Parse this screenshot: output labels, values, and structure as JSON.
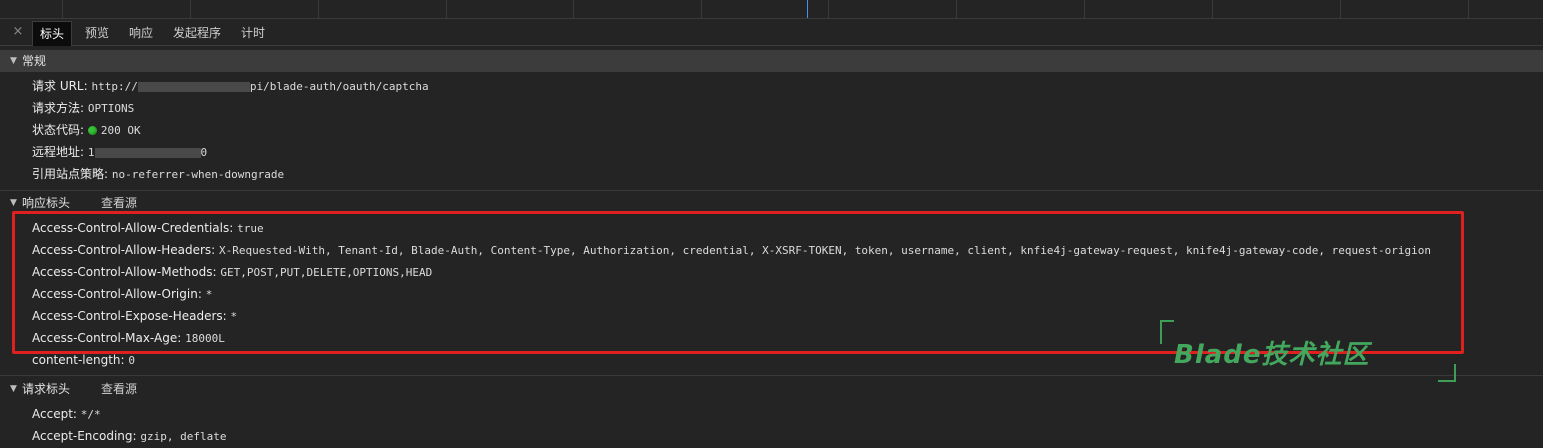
{
  "tabs": {
    "close": "×",
    "items": [
      "标头",
      "预览",
      "响应",
      "发起程序",
      "计时"
    ],
    "active": "标头"
  },
  "general": {
    "title": "常规",
    "request_url_label": "请求 URL:",
    "request_url_prefix": "http://",
    "request_url_suffix": "pi/blade-auth/oauth/captcha",
    "request_method_label": "请求方法:",
    "request_method": "OPTIONS",
    "status_code_label": "状态代码:",
    "status_code": "200 OK",
    "remote_address_label": "远程地址:",
    "remote_address_prefix": "1",
    "remote_address_suffix": "0",
    "referrer_policy_label": "引用站点策略:",
    "referrer_policy": "no-referrer-when-downgrade"
  },
  "response_headers": {
    "title": "响应标头",
    "view_source": "查看源",
    "items": [
      {
        "key": "Access-Control-Allow-Credentials:",
        "value": "true"
      },
      {
        "key": "Access-Control-Allow-Headers:",
        "value": "X-Requested-With, Tenant-Id, Blade-Auth, Content-Type, Authorization, credential, X-XSRF-TOKEN, token, username, client, knfie4j-gateway-request, knife4j-gateway-code, request-origion"
      },
      {
        "key": "Access-Control-Allow-Methods:",
        "value": "GET,POST,PUT,DELETE,OPTIONS,HEAD"
      },
      {
        "key": "Access-Control-Allow-Origin:",
        "value": "*"
      },
      {
        "key": "Access-Control-Expose-Headers:",
        "value": "*"
      },
      {
        "key": "Access-Control-Max-Age:",
        "value": "18000L"
      },
      {
        "key": "content-length:",
        "value": "0"
      }
    ]
  },
  "request_headers": {
    "title": "请求标头",
    "view_source": "查看源",
    "items": [
      {
        "key": "Accept:",
        "value": "*/*"
      },
      {
        "key": "Accept-Encoding:",
        "value": "gzip, deflate"
      }
    ]
  },
  "watermark": {
    "text": "Blade技术社区"
  },
  "colors": {
    "background": "#242424",
    "section_bar": "#3c3c3c",
    "highlight": "#e0201e",
    "status_ok": "#36c236",
    "watermark": "#43a85e"
  }
}
